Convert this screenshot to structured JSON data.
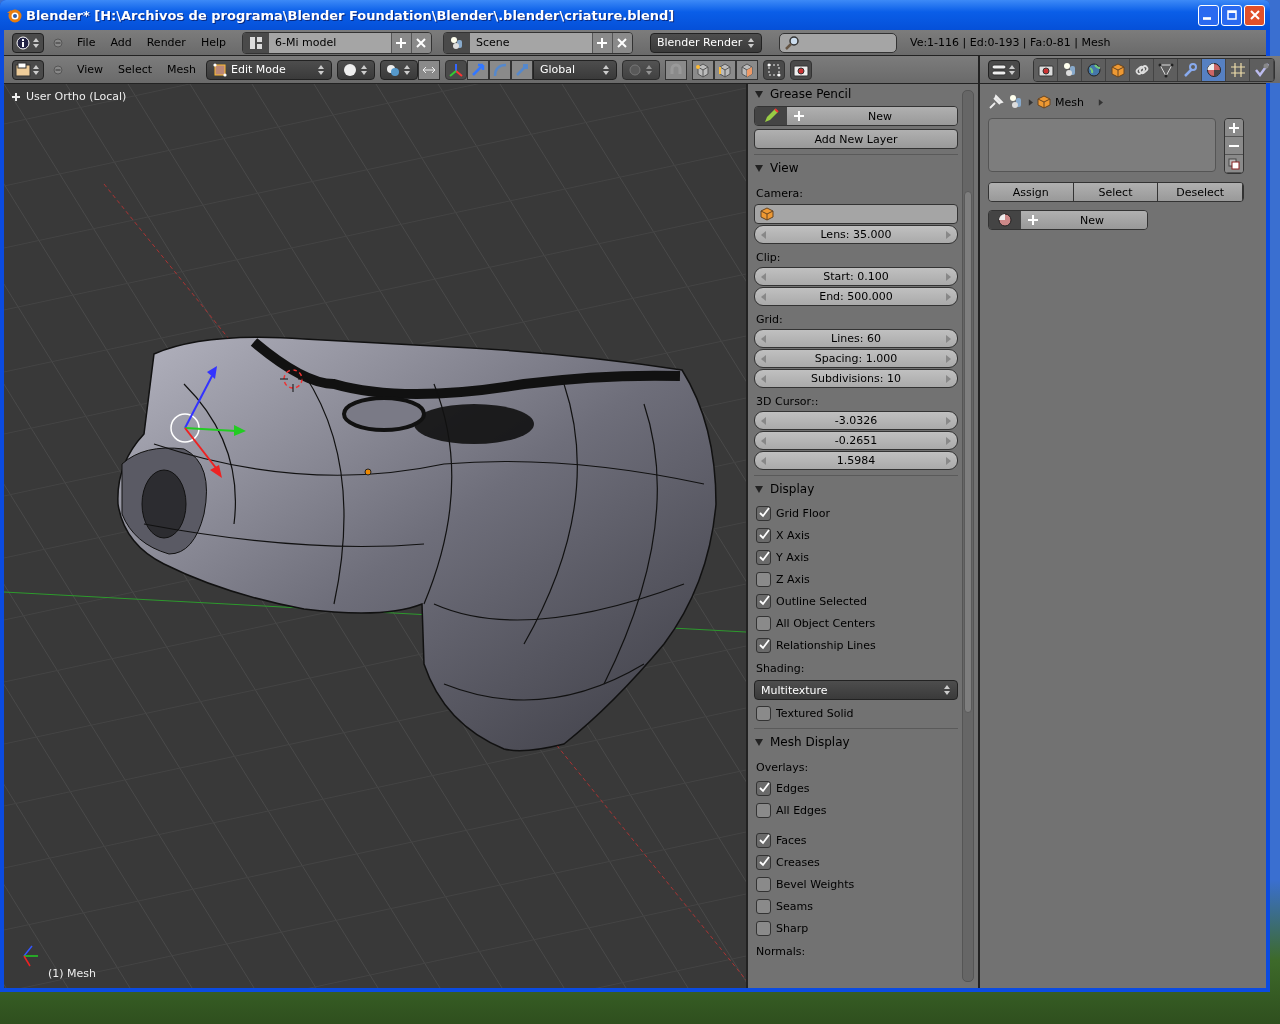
{
  "window": {
    "title": "Blender* [H:\\Archivos de programa\\Blender Foundation\\Blender\\.blender\\criature.blend]"
  },
  "info_header": {
    "menus": [
      "File",
      "Add",
      "Render",
      "Help"
    ],
    "screen": "6-Mi model",
    "scene": "Scene",
    "render_engine": "Blender Render",
    "stats": "Ve:1-116 | Ed:0-193 | Fa:0-81 | Mesh"
  },
  "view_header": {
    "menus": [
      "View",
      "Select",
      "Mesh"
    ],
    "mode": "Edit Mode",
    "orientation": "Global"
  },
  "viewport": {
    "view_name": "User Ortho (Local)",
    "object_name": "(1) Mesh"
  },
  "n_panel": {
    "grease_pencil": {
      "title": "Grease Pencil",
      "new_button": "New",
      "add_layer_button": "Add New Layer"
    },
    "sections": [
      {
        "title": "View",
        "expanded": true,
        "items": [
          {
            "kind": "label",
            "text": "Camera:"
          },
          {
            "kind": "object_field"
          },
          {
            "kind": "number",
            "text": "Lens: 35.000"
          },
          {
            "kind": "label",
            "text": "Clip:"
          },
          {
            "kind": "number",
            "text": "Start: 0.100"
          },
          {
            "kind": "number",
            "text": "End: 500.000"
          },
          {
            "kind": "label",
            "text": "Grid:"
          },
          {
            "kind": "number",
            "text": "Lines: 60"
          },
          {
            "kind": "number",
            "text": "Spacing: 1.000"
          },
          {
            "kind": "number",
            "text": "Subdivisions: 10"
          },
          {
            "kind": "label",
            "text": "3D Cursor::"
          },
          {
            "kind": "number",
            "text": "-3.0326"
          },
          {
            "kind": "number",
            "text": "-0.2651"
          },
          {
            "kind": "number",
            "text": "1.5984"
          }
        ]
      },
      {
        "title": "Display",
        "expanded": true,
        "items": [
          {
            "kind": "checkbox",
            "text": "Grid Floor",
            "checked": true
          },
          {
            "kind": "checkbox",
            "text": "X Axis",
            "checked": true
          },
          {
            "kind": "checkbox",
            "text": "Y Axis",
            "checked": true
          },
          {
            "kind": "checkbox",
            "text": "Z Axis",
            "checked": false
          },
          {
            "kind": "checkbox",
            "text": "Outline Selected",
            "checked": true
          },
          {
            "kind": "checkbox",
            "text": "All Object Centers",
            "checked": false
          },
          {
            "kind": "checkbox",
            "text": "Relationship Lines",
            "checked": true
          },
          {
            "kind": "label",
            "text": "Shading:"
          },
          {
            "kind": "dropdown",
            "text": "Multitexture"
          },
          {
            "kind": "checkbox",
            "text": "Textured Solid",
            "checked": false
          }
        ]
      },
      {
        "title": "Mesh Display",
        "expanded": true,
        "items": [
          {
            "kind": "label",
            "text": "Overlays:"
          },
          {
            "kind": "checkbox",
            "text": "Edges",
            "checked": true
          },
          {
            "kind": "checkbox",
            "text": "All Edges",
            "checked": false
          },
          {
            "kind": "spacer"
          },
          {
            "kind": "checkbox",
            "text": "Faces",
            "checked": true
          },
          {
            "kind": "checkbox",
            "text": "Creases",
            "checked": true
          },
          {
            "kind": "checkbox",
            "text": "Bevel Weights",
            "checked": false
          },
          {
            "kind": "checkbox",
            "text": "Seams",
            "checked": false
          },
          {
            "kind": "checkbox",
            "text": "Sharp",
            "checked": false
          },
          {
            "kind": "label",
            "text": "Normals:"
          }
        ]
      }
    ]
  },
  "properties": {
    "tabs": [
      {
        "kind": "render",
        "selected": false
      },
      {
        "kind": "scene",
        "selected": false
      },
      {
        "kind": "world",
        "selected": false
      },
      {
        "kind": "object",
        "selected": false
      },
      {
        "kind": "constraints",
        "selected": false
      },
      {
        "kind": "data",
        "selected": false
      },
      {
        "kind": "modifiers",
        "selected": false
      },
      {
        "kind": "material",
        "selected": true
      },
      {
        "kind": "particles",
        "selected": false
      },
      {
        "kind": "physics",
        "selected": false
      }
    ],
    "breadcrumb": "Mesh",
    "slot_buttons": [
      "Assign",
      "Select",
      "Deselect"
    ],
    "new_material_button": "New"
  }
}
